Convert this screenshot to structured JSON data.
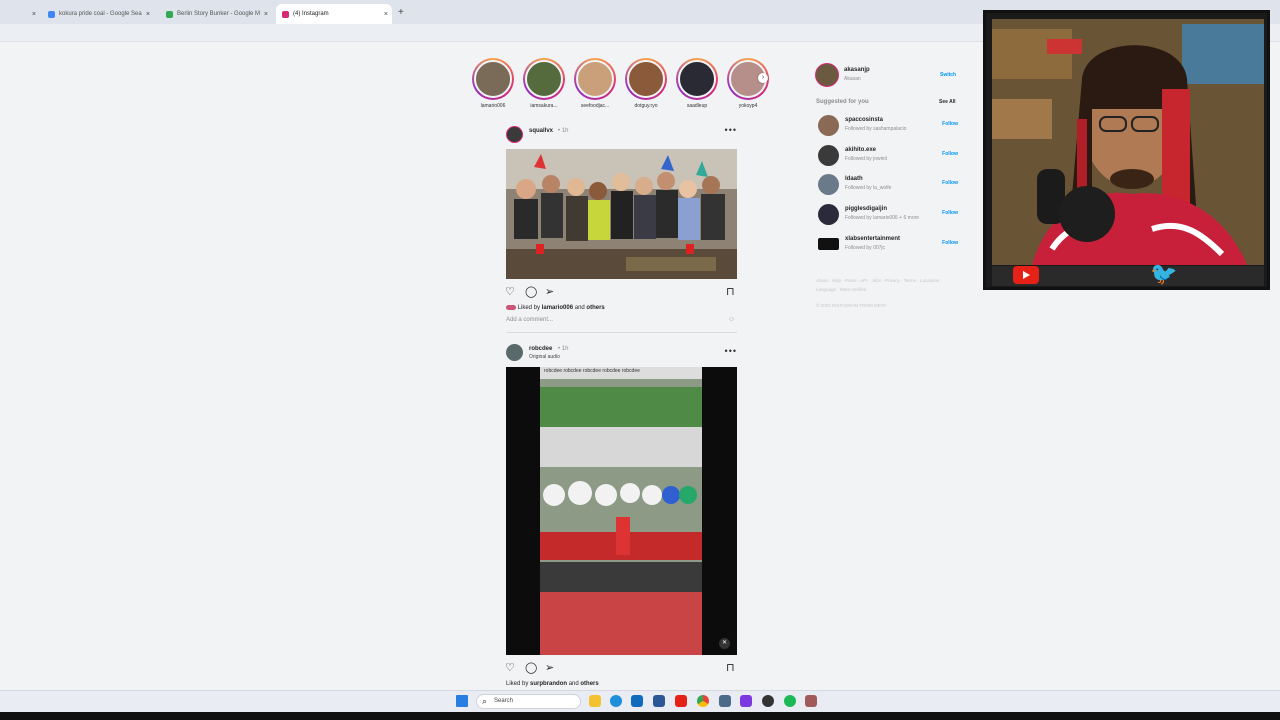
{
  "browser": {
    "tabs": [
      {
        "label": "kokura pride coal - Google Sea",
        "favicon_color": "#4285f4"
      },
      {
        "label": "Berlin Story Bunker - Google M",
        "favicon_color": "#34a853"
      },
      {
        "label": "(4) Instagram",
        "favicon_color": "#d62976"
      }
    ],
    "newtab_glyph": "+",
    "close_glyph": "×"
  },
  "stories": [
    {
      "name": "lamario006",
      "color": "#7a6a58"
    },
    {
      "name": "iamsakura...",
      "color": "#556b3e"
    },
    {
      "name": "seefoodjac...",
      "color": "#caa07a"
    },
    {
      "name": "dotguy.ryo",
      "color": "#8a5a3a"
    },
    {
      "name": "saadleup",
      "color": "#2a2a35"
    },
    {
      "name": "yokoyp4",
      "color": "#b78f8a"
    }
  ],
  "posts": [
    {
      "user": "squallvx",
      "time": "• 1h",
      "subtitle": "",
      "liked_by_prefix": "Liked by",
      "liked_by_user": "lamario006",
      "liked_by_suffix": "and",
      "liked_by_others": "others",
      "add_comment": "Add a comment..."
    },
    {
      "user": "robcdee",
      "time": "• 1h",
      "subtitle": "Original audio",
      "liked_by_prefix": "Liked by",
      "liked_by_user": "surpbrandon",
      "liked_by_suffix": "and",
      "liked_by_others": "others"
    }
  ],
  "video_overlay_text": "robcdee  robcdee  robcdee  robcdee  robcdee",
  "sidebar": {
    "me_username": "akasanjp",
    "me_fullname": "Akasan",
    "switch_label": "Switch",
    "suggested_title": "Suggested for you",
    "see_all": "See All",
    "suggestions": [
      {
        "name": "spaccosinsta",
        "sub": "Followed by sashampalacio",
        "follow": "Follow",
        "color": "#8a6a55"
      },
      {
        "name": "akihito.exe",
        "sub": "Followed by jowinit",
        "follow": "Follow",
        "color": "#3a3a3a"
      },
      {
        "name": "ldaath",
        "sub": "Followed by la_wolfe",
        "follow": "Follow",
        "color": "#6a7a8a"
      },
      {
        "name": "pigglesdigaijin",
        "sub": "Followed by lamario006 + 6 more",
        "follow": "Follow",
        "color": "#2a2a3a"
      },
      {
        "name": "xlabsentertainment",
        "sub": "Followed by 007jc",
        "follow": "Follow",
        "color": "#111111"
      }
    ],
    "footer_links": "About · Help · Press · API · Jobs · Privacy · Terms · Locations · Language · Meta Verified",
    "copyright": "© 2023 INSTAGRAM FROM META"
  },
  "taskbar": {
    "search_label": "Search"
  },
  "colors": {
    "ig_blue": "#0095f6",
    "ig_gradient_pink": "#d62976",
    "youtube_red": "#e62117",
    "twitter_blue": "#1da1f2"
  }
}
